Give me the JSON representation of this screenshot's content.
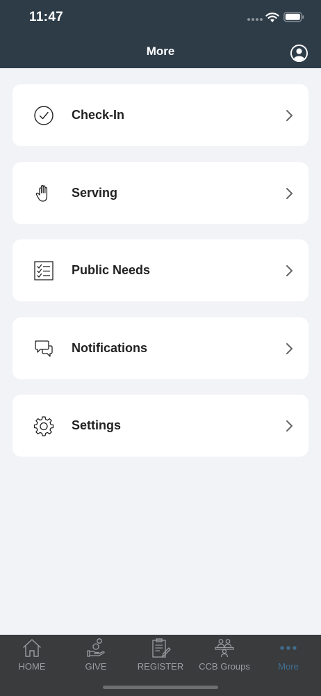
{
  "status_bar": {
    "time": "11:47"
  },
  "header": {
    "title": "More",
    "profile_icon": "profile-icon"
  },
  "menu": {
    "items": [
      {
        "label": "Check-In",
        "icon": "check-circle-icon"
      },
      {
        "label": "Serving",
        "icon": "hand-icon"
      },
      {
        "label": "Public Needs",
        "icon": "checklist-icon"
      },
      {
        "label": "Notifications",
        "icon": "chat-bubbles-icon"
      },
      {
        "label": "Settings",
        "icon": "gear-icon"
      }
    ]
  },
  "tabbar": {
    "active": "More",
    "tabs": [
      {
        "label": "HOME",
        "icon": "home-icon"
      },
      {
        "label": "GIVE",
        "icon": "give-icon"
      },
      {
        "label": "REGISTER",
        "icon": "clipboard-icon"
      },
      {
        "label": "CCB Groups",
        "icon": "groups-icon"
      },
      {
        "label": "More",
        "icon": "more-icon"
      }
    ]
  },
  "colors": {
    "header_bg": "#2e3c48",
    "tabbar_bg": "#3a3b3d",
    "active_tab": "#3f6f91",
    "page_bg": "#f2f3f7"
  }
}
